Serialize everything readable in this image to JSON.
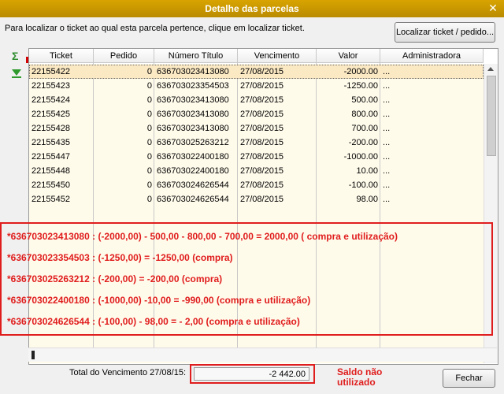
{
  "window": {
    "title": "Detalhe das parcelas",
    "close_glyph": "✕"
  },
  "instruction": "Para localizar o ticket ao qual esta parcela pertence, clique em localizar ticket.",
  "buttons": {
    "locate": "Localizar ticket / pedido...",
    "close": "Fechar"
  },
  "toolbar": {
    "sum_icon": "Σ",
    "expand_icon": "expand-down-icon"
  },
  "table": {
    "columns": [
      "Ticket",
      "Pedido",
      "Número Título",
      "Vencimento",
      "Valor",
      "Administradora"
    ],
    "rows": [
      [
        "22155422",
        "0",
        "636703023413080",
        "27/08/2015",
        "-2000.00",
        "..."
      ],
      [
        "22155423",
        "0",
        "636703023354503",
        "27/08/2015",
        "-1250.00",
        "..."
      ],
      [
        "22155424",
        "0",
        "636703023413080",
        "27/08/2015",
        "500.00",
        "..."
      ],
      [
        "22155425",
        "0",
        "636703023413080",
        "27/08/2015",
        "800.00",
        "..."
      ],
      [
        "22155428",
        "0",
        "636703023413080",
        "27/08/2015",
        "700.00",
        "..."
      ],
      [
        "22155435",
        "0",
        "636703025263212",
        "27/08/2015",
        "-200.00",
        "..."
      ],
      [
        "22155447",
        "0",
        "636703022400180",
        "27/08/2015",
        "-1000.00",
        "..."
      ],
      [
        "22155448",
        "0",
        "636703022400180",
        "27/08/2015",
        "10.00",
        "..."
      ],
      [
        "22155450",
        "0",
        "636703024626544",
        "27/08/2015",
        "-100.00",
        "..."
      ],
      [
        "22155452",
        "0",
        "636703024626544",
        "27/08/2015",
        "98.00",
        "..."
      ]
    ]
  },
  "annotations": [
    "*636703023413080 : (-2000,00) - 500,00 - 800,00 - 700,00 = 2000,00 ( compra e utilização)",
    "*636703023354503 : (-1250,00) = -1250,00 (compra)",
    "*636703025263212 : (-200,00) = -200,00 (compra)",
    "*636703022400180 : (-1000,00) -10,00 = -990,00 (compra e utilização)",
    "*636703024626544 : (-100,00) - 98,00 = - 2,00 (compra e utilização)"
  ],
  "total": {
    "label": "Total do Vencimento 27/08/15:",
    "value": "-2 442.00"
  },
  "note": {
    "line1": "Saldo não",
    "line2": "utilizado"
  },
  "colors": {
    "titlebar": "#c99700",
    "annotation": "#e01d1d",
    "grid_bg": "#fffbeb",
    "selected_row": "#fbe9c4"
  }
}
